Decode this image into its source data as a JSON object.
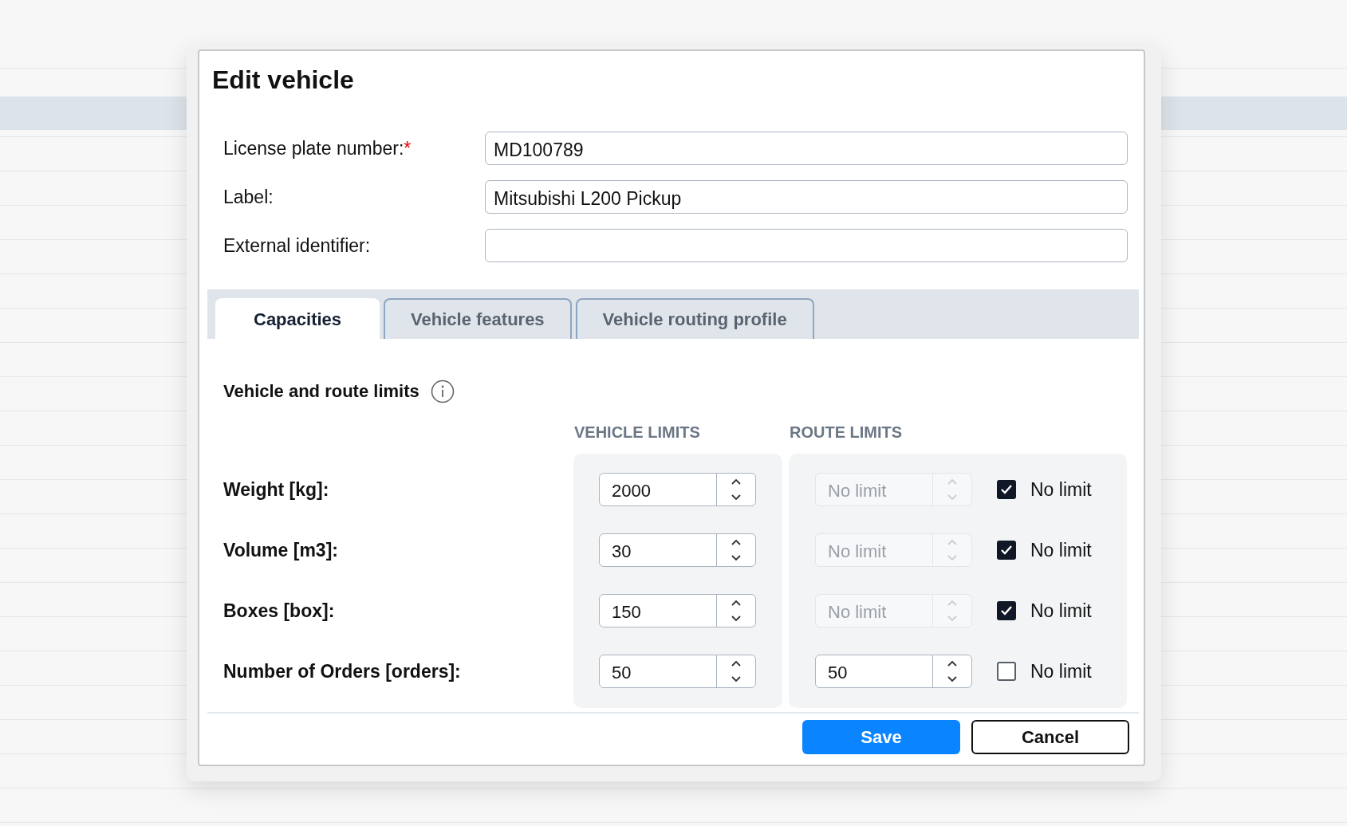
{
  "dialog": {
    "title": "Edit vehicle"
  },
  "fields": [
    {
      "label": "License plate number:",
      "required_mark": "*",
      "value": "MD100789"
    },
    {
      "label": "Label:",
      "value": "Mitsubishi L200 Pickup"
    },
    {
      "label": "External identifier:"
    }
  ],
  "tabs": [
    {
      "label": "Capacities",
      "selected": true
    },
    {
      "label": "Vehicle features",
      "selected": false
    },
    {
      "label": "Vehicle routing profile",
      "selected": false
    }
  ],
  "section": {
    "title": "Vehicle and route limits"
  },
  "columns": [
    "VEHICLE LIMITS",
    "ROUTE LIMITS"
  ],
  "limits": [
    {
      "label": "Weight [kg]:",
      "vehicle": {
        "value": "2000"
      },
      "route": {
        "placeholder": "No limit",
        "disabled": true
      },
      "no_limit": {
        "label": "No limit",
        "checked": true
      }
    },
    {
      "label": "Volume [m3]:",
      "vehicle": {
        "value": "30"
      },
      "route": {
        "placeholder": "No limit",
        "disabled": true
      },
      "no_limit": {
        "label": "No limit",
        "checked": true
      }
    },
    {
      "label": "Boxes [box]:",
      "vehicle": {
        "value": "150"
      },
      "route": {
        "placeholder": "No limit",
        "disabled": true
      },
      "no_limit": {
        "label": "No limit",
        "checked": true
      }
    },
    {
      "label": "Number of Orders [orders]:",
      "vehicle": {
        "value": "50"
      },
      "route": {
        "value": "50",
        "disabled": false
      },
      "no_limit": {
        "label": "No limit",
        "checked": false
      }
    }
  ],
  "buttons": [
    {
      "label": "Save",
      "kind": "primary"
    },
    {
      "label": "Cancel",
      "kind": "secondary"
    }
  ]
}
